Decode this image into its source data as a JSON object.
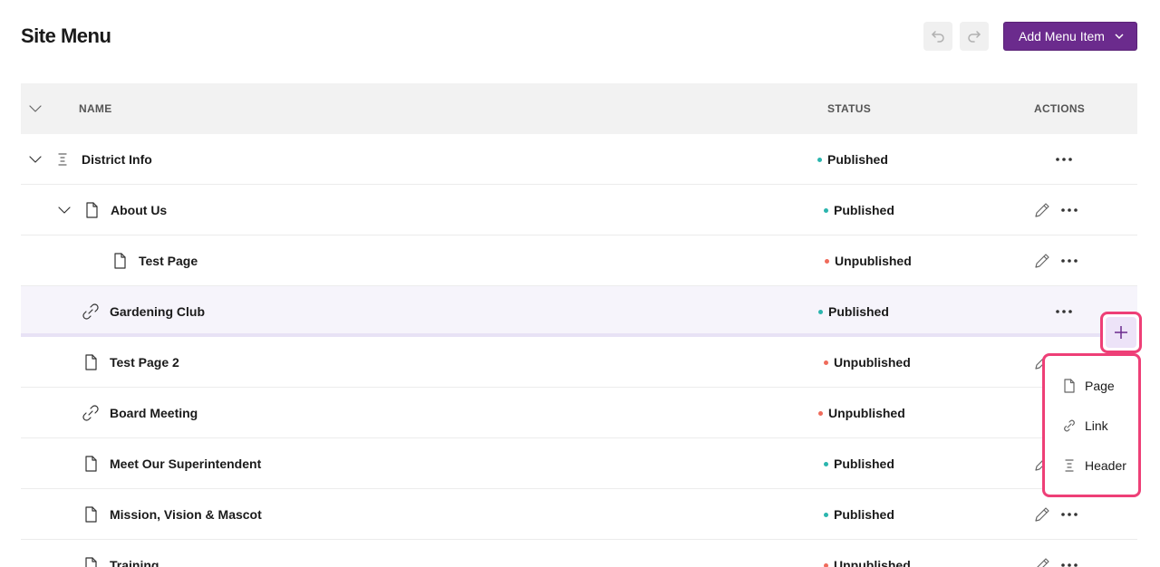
{
  "header": {
    "title": "Site Menu",
    "add_button_label": "Add Menu Item"
  },
  "table": {
    "columns": {
      "name": "NAME",
      "status": "STATUS",
      "actions": "ACTIONS"
    },
    "rows": [
      {
        "name": "District Info",
        "type": "header",
        "status": "Published"
      },
      {
        "name": "About Us",
        "type": "page",
        "status": "Published"
      },
      {
        "name": "Test Page",
        "type": "page",
        "status": "Unpublished"
      },
      {
        "name": "Gardening Club",
        "type": "link",
        "status": "Published"
      },
      {
        "name": "Test Page 2",
        "type": "page",
        "status": "Unpublished"
      },
      {
        "name": "Board Meeting",
        "type": "link",
        "status": "Unpublished"
      },
      {
        "name": "Meet Our Superintendent",
        "type": "page",
        "status": "Published"
      },
      {
        "name": "Mission, Vision & Mascot",
        "type": "page",
        "status": "Published"
      },
      {
        "name": "Training",
        "type": "page",
        "status": "Unpublished"
      }
    ]
  },
  "add_menu": {
    "items": [
      {
        "label": "Page",
        "icon": "page-icon"
      },
      {
        "label": "Link",
        "icon": "link-icon"
      },
      {
        "label": "Header",
        "icon": "header-icon"
      }
    ]
  },
  "colors": {
    "brand": "#6b2b8d",
    "published": "#2bb5ae",
    "unpublished": "#ef6b5b",
    "highlight": "#ee3f77"
  }
}
